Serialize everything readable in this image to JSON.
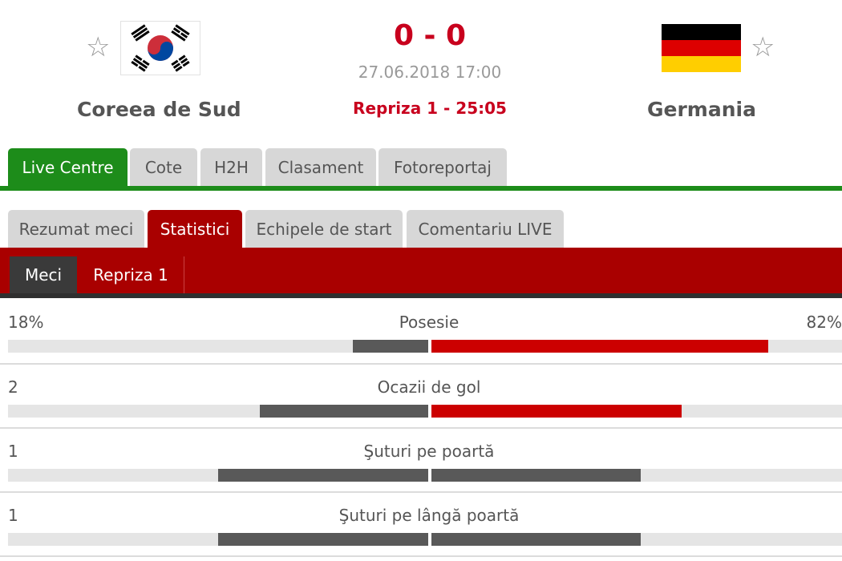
{
  "match": {
    "home": {
      "name": "Coreea de Sud",
      "flag_icon": "south-korea-flag-icon"
    },
    "away": {
      "name": "Germania",
      "flag_icon": "germany-flag-icon"
    },
    "score": "0 - 0",
    "datetime": "27.06.2018 17:00",
    "period": "Repriza 1 - 25:05",
    "favorite_icon": "star-outline-icon"
  },
  "main_tabs": [
    "Live Centre",
    "Cote",
    "H2H",
    "Clasament",
    "Fotoreportaj"
  ],
  "sub_tabs": [
    "Rezumat meci",
    "Statistici",
    "Echipele de start",
    "Comentariu LIVE"
  ],
  "period_tabs": [
    "Meci",
    "Repriza 1"
  ],
  "colors": {
    "green": "#1d8c1a",
    "red": "#a90000",
    "score_red": "#c8001d",
    "bar_red": "#cc0000",
    "bar_dark": "#595959",
    "bar_track": "#e5e5e5"
  },
  "stats": [
    {
      "label": "Posesie",
      "home_text": "18%",
      "away_text": "82%",
      "home_fill": 0.18,
      "away_fill": 0.82
    },
    {
      "label": "Ocazii de gol",
      "home_text": "2",
      "away_text": "",
      "home_fill": 0.4,
      "away_fill": 0.61
    },
    {
      "label": "Şuturi pe poartă",
      "home_text": "1",
      "away_text": "",
      "home_fill": 0.5,
      "away_fill": 0.51
    },
    {
      "label": "Şuturi pe lângă poartă",
      "home_text": "1",
      "away_text": "",
      "home_fill": 0.5,
      "away_fill": 0.51
    }
  ]
}
